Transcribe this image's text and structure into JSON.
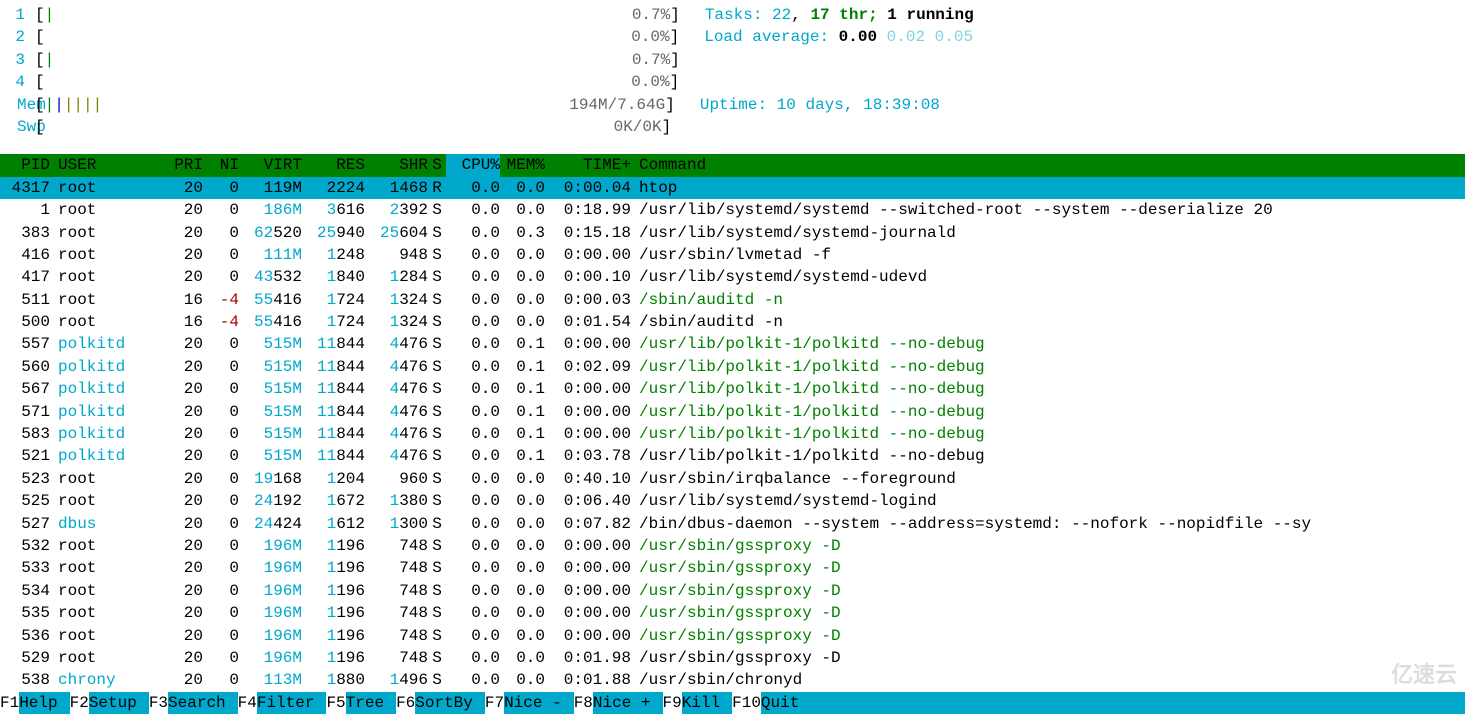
{
  "cpus": [
    {
      "num": "1",
      "bar": "|",
      "pct": "0.7%"
    },
    {
      "num": "2",
      "bar": "",
      "pct": "0.0%"
    },
    {
      "num": "3",
      "bar": "|",
      "pct": "0.7%"
    },
    {
      "num": "4",
      "bar": "",
      "pct": "0.0%"
    }
  ],
  "mem": {
    "label": "Mem",
    "bars": "||||||",
    "used": "194M/7.64G"
  },
  "swp": {
    "label": "Swp",
    "used": "0K/0K"
  },
  "stats": {
    "tasks_label": "Tasks:",
    "tasks_count": "22",
    "tasks_sep": ",",
    "threads": "17",
    "threads_label": "thr;",
    "running": "1",
    "running_label": "running",
    "load_label": "Load average:",
    "load1": "0.00",
    "load2": "0.02",
    "load3": "0.05",
    "uptime_label": "Uptime:",
    "uptime_val": "10 days, 18:39:08"
  },
  "columns": {
    "pid": "PID",
    "user": "USER",
    "pri": "PRI",
    "ni": "NI",
    "virt": "VIRT",
    "res": "RES",
    "shr": "SHR",
    "s": "S",
    "cpu": "CPU%",
    "mem": "MEM%",
    "time": "TIME+",
    "command": "Command"
  },
  "processes": [
    {
      "hl": true,
      "pid": "4317",
      "user": "root",
      "pri": "20",
      "ni": "0",
      "virt": "119M",
      "res": "2224",
      "shr": "1468",
      "s": "R",
      "cpu": "0.0",
      "mem": "0.0",
      "time": "0:00.04",
      "cmd": "htop",
      "cmd_green": false
    },
    {
      "hl": false,
      "pid": "1",
      "user": "root",
      "pri": "20",
      "ni": "0",
      "virt": "186M",
      "res": "3616",
      "shr": "2392",
      "s": "S",
      "cpu": "0.0",
      "mem": "0.0",
      "time": "0:18.99",
      "cmd": "/usr/lib/systemd/systemd --switched-root --system --deserialize 20",
      "cmd_green": false
    },
    {
      "hl": false,
      "pid": "383",
      "user": "root",
      "pri": "20",
      "ni": "0",
      "virt": "62520",
      "res": "25940",
      "shr": "25604",
      "s": "S",
      "cpu": "0.0",
      "mem": "0.3",
      "time": "0:15.18",
      "cmd": "/usr/lib/systemd/systemd-journald",
      "cmd_green": false
    },
    {
      "hl": false,
      "pid": "416",
      "user": "root",
      "pri": "20",
      "ni": "0",
      "virt": "111M",
      "res": "1248",
      "shr": "948",
      "s": "S",
      "cpu": "0.0",
      "mem": "0.0",
      "time": "0:00.00",
      "cmd": "/usr/sbin/lvmetad -f",
      "cmd_green": false
    },
    {
      "hl": false,
      "pid": "417",
      "user": "root",
      "pri": "20",
      "ni": "0",
      "virt": "43532",
      "res": "1840",
      "shr": "1284",
      "s": "S",
      "cpu": "0.0",
      "mem": "0.0",
      "time": "0:00.10",
      "cmd": "/usr/lib/systemd/systemd-udevd",
      "cmd_green": false
    },
    {
      "hl": false,
      "pid": "511",
      "user": "root",
      "pri": "16",
      "ni": "-4",
      "virt": "55416",
      "res": "1724",
      "shr": "1324",
      "s": "S",
      "cpu": "0.0",
      "mem": "0.0",
      "time": "0:00.03",
      "cmd": "/sbin/auditd -n",
      "cmd_green": true
    },
    {
      "hl": false,
      "pid": "500",
      "user": "root",
      "pri": "16",
      "ni": "-4",
      "virt": "55416",
      "res": "1724",
      "shr": "1324",
      "s": "S",
      "cpu": "0.0",
      "mem": "0.0",
      "time": "0:01.54",
      "cmd": "/sbin/auditd -n",
      "cmd_green": false
    },
    {
      "hl": false,
      "pid": "557",
      "user": "polkitd",
      "pri": "20",
      "ni": "0",
      "virt": "515M",
      "res": "11844",
      "shr": "4476",
      "s": "S",
      "cpu": "0.0",
      "mem": "0.1",
      "time": "0:00.00",
      "cmd": "/usr/lib/polkit-1/polkitd --no-debug",
      "cmd_green": true
    },
    {
      "hl": false,
      "pid": "560",
      "user": "polkitd",
      "pri": "20",
      "ni": "0",
      "virt": "515M",
      "res": "11844",
      "shr": "4476",
      "s": "S",
      "cpu": "0.0",
      "mem": "0.1",
      "time": "0:02.09",
      "cmd": "/usr/lib/polkit-1/polkitd --no-debug",
      "cmd_green": true
    },
    {
      "hl": false,
      "pid": "567",
      "user": "polkitd",
      "pri": "20",
      "ni": "0",
      "virt": "515M",
      "res": "11844",
      "shr": "4476",
      "s": "S",
      "cpu": "0.0",
      "mem": "0.1",
      "time": "0:00.00",
      "cmd": "/usr/lib/polkit-1/polkitd --no-debug",
      "cmd_green": true
    },
    {
      "hl": false,
      "pid": "571",
      "user": "polkitd",
      "pri": "20",
      "ni": "0",
      "virt": "515M",
      "res": "11844",
      "shr": "4476",
      "s": "S",
      "cpu": "0.0",
      "mem": "0.1",
      "time": "0:00.00",
      "cmd": "/usr/lib/polkit-1/polkitd --no-debug",
      "cmd_green": true
    },
    {
      "hl": false,
      "pid": "583",
      "user": "polkitd",
      "pri": "20",
      "ni": "0",
      "virt": "515M",
      "res": "11844",
      "shr": "4476",
      "s": "S",
      "cpu": "0.0",
      "mem": "0.1",
      "time": "0:00.00",
      "cmd": "/usr/lib/polkit-1/polkitd --no-debug",
      "cmd_green": true
    },
    {
      "hl": false,
      "pid": "521",
      "user": "polkitd",
      "pri": "20",
      "ni": "0",
      "virt": "515M",
      "res": "11844",
      "shr": "4476",
      "s": "S",
      "cpu": "0.0",
      "mem": "0.1",
      "time": "0:03.78",
      "cmd": "/usr/lib/polkit-1/polkitd --no-debug",
      "cmd_green": false
    },
    {
      "hl": false,
      "pid": "523",
      "user": "root",
      "pri": "20",
      "ni": "0",
      "virt": "19168",
      "res": "1204",
      "shr": "960",
      "s": "S",
      "cpu": "0.0",
      "mem": "0.0",
      "time": "0:40.10",
      "cmd": "/usr/sbin/irqbalance --foreground",
      "cmd_green": false
    },
    {
      "hl": false,
      "pid": "525",
      "user": "root",
      "pri": "20",
      "ni": "0",
      "virt": "24192",
      "res": "1672",
      "shr": "1380",
      "s": "S",
      "cpu": "0.0",
      "mem": "0.0",
      "time": "0:06.40",
      "cmd": "/usr/lib/systemd/systemd-logind",
      "cmd_green": false
    },
    {
      "hl": false,
      "pid": "527",
      "user": "dbus",
      "pri": "20",
      "ni": "0",
      "virt": "24424",
      "res": "1612",
      "shr": "1300",
      "s": "S",
      "cpu": "0.0",
      "mem": "0.0",
      "time": "0:07.82",
      "cmd": "/bin/dbus-daemon --system --address=systemd: --nofork --nopidfile --sy",
      "cmd_green": false
    },
    {
      "hl": false,
      "pid": "532",
      "user": "root",
      "pri": "20",
      "ni": "0",
      "virt": "196M",
      "res": "1196",
      "shr": "748",
      "s": "S",
      "cpu": "0.0",
      "mem": "0.0",
      "time": "0:00.00",
      "cmd": "/usr/sbin/gssproxy -D",
      "cmd_green": true
    },
    {
      "hl": false,
      "pid": "533",
      "user": "root",
      "pri": "20",
      "ni": "0",
      "virt": "196M",
      "res": "1196",
      "shr": "748",
      "s": "S",
      "cpu": "0.0",
      "mem": "0.0",
      "time": "0:00.00",
      "cmd": "/usr/sbin/gssproxy -D",
      "cmd_green": true
    },
    {
      "hl": false,
      "pid": "534",
      "user": "root",
      "pri": "20",
      "ni": "0",
      "virt": "196M",
      "res": "1196",
      "shr": "748",
      "s": "S",
      "cpu": "0.0",
      "mem": "0.0",
      "time": "0:00.00",
      "cmd": "/usr/sbin/gssproxy -D",
      "cmd_green": true
    },
    {
      "hl": false,
      "pid": "535",
      "user": "root",
      "pri": "20",
      "ni": "0",
      "virt": "196M",
      "res": "1196",
      "shr": "748",
      "s": "S",
      "cpu": "0.0",
      "mem": "0.0",
      "time": "0:00.00",
      "cmd": "/usr/sbin/gssproxy -D",
      "cmd_green": true
    },
    {
      "hl": false,
      "pid": "536",
      "user": "root",
      "pri": "20",
      "ni": "0",
      "virt": "196M",
      "res": "1196",
      "shr": "748",
      "s": "S",
      "cpu": "0.0",
      "mem": "0.0",
      "time": "0:00.00",
      "cmd": "/usr/sbin/gssproxy -D",
      "cmd_green": true
    },
    {
      "hl": false,
      "pid": "529",
      "user": "root",
      "pri": "20",
      "ni": "0",
      "virt": "196M",
      "res": "1196",
      "shr": "748",
      "s": "S",
      "cpu": "0.0",
      "mem": "0.0",
      "time": "0:01.98",
      "cmd": "/usr/sbin/gssproxy -D",
      "cmd_green": false
    },
    {
      "hl": false,
      "pid": "538",
      "user": "chrony",
      "pri": "20",
      "ni": "0",
      "virt": "113M",
      "res": "1880",
      "shr": "1496",
      "s": "S",
      "cpu": "0.0",
      "mem": "0.0",
      "time": "0:01.88",
      "cmd": "/usr/sbin/chronyd",
      "cmd_green": false
    }
  ],
  "footer": [
    {
      "key": "F1",
      "label": "Help"
    },
    {
      "key": "F2",
      "label": "Setup"
    },
    {
      "key": "F3",
      "label": "Search"
    },
    {
      "key": "F4",
      "label": "Filter"
    },
    {
      "key": "F5",
      "label": "Tree"
    },
    {
      "key": "F6",
      "label": "SortBy"
    },
    {
      "key": "F7",
      "label": "Nice -"
    },
    {
      "key": "F8",
      "label": "Nice +"
    },
    {
      "key": "F9",
      "label": "Kill"
    },
    {
      "key": "F10",
      "label": "Quit"
    }
  ],
  "watermark": "亿速云"
}
